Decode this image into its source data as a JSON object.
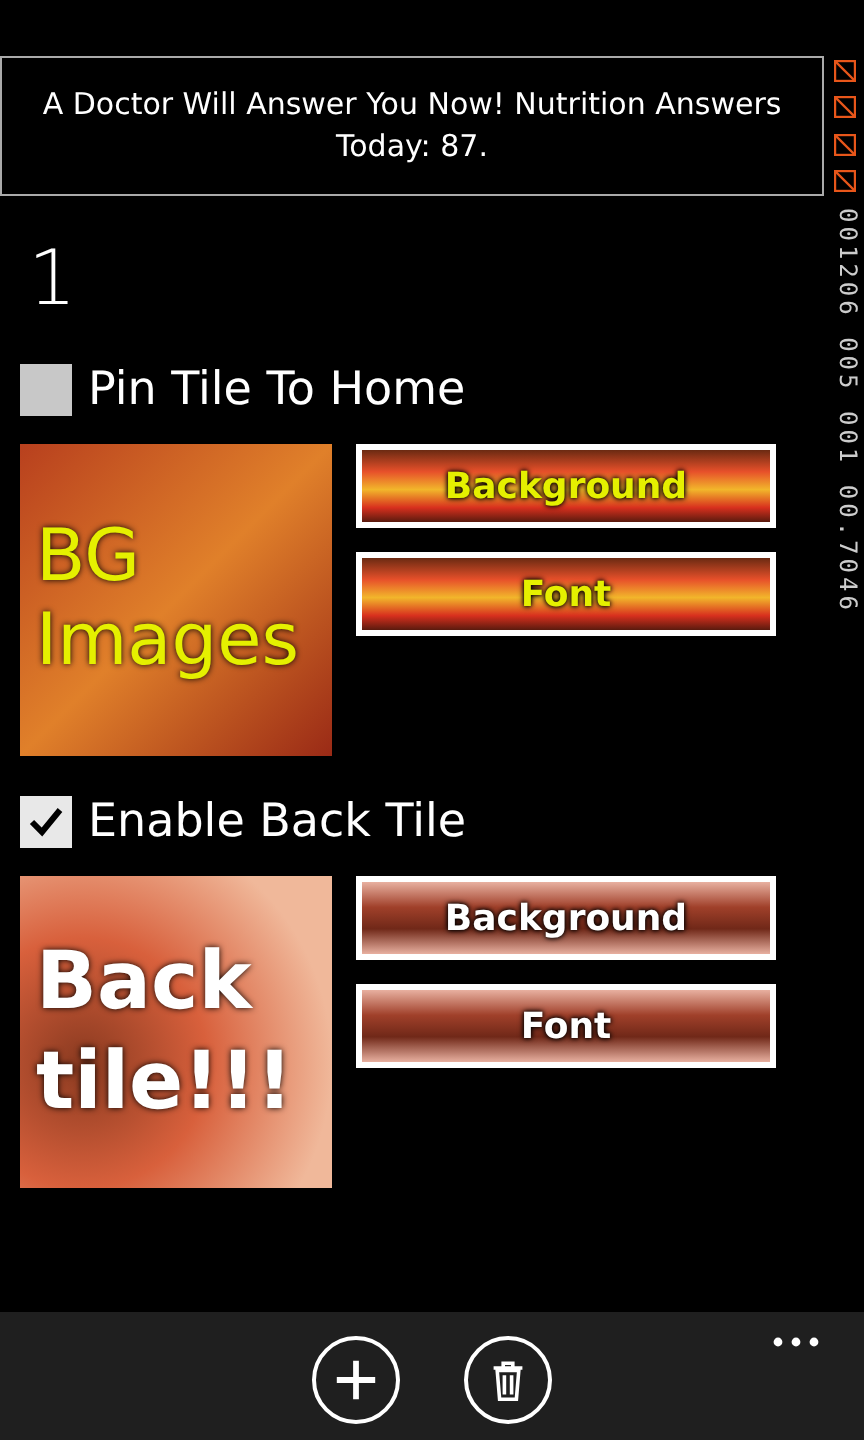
{
  "ad": {
    "text": "A Doctor Will Answer You Now! Nutrition Answers Today: 87."
  },
  "counter": "001206 005 001 00.7046",
  "title": "1",
  "sections": [
    {
      "label": "Pin Tile To Home",
      "checked": false,
      "tile_text": "BG Images",
      "kind": "mango",
      "buttons": [
        "Background",
        "Font"
      ]
    },
    {
      "label": "Enable Back Tile",
      "checked": true,
      "tile_text": "Back tile!!!",
      "kind": "flower",
      "buttons": [
        "Background",
        "Font"
      ]
    }
  ],
  "app_bar": {
    "buttons": [
      {
        "kind": "add"
      },
      {
        "kind": "delete"
      }
    ]
  }
}
